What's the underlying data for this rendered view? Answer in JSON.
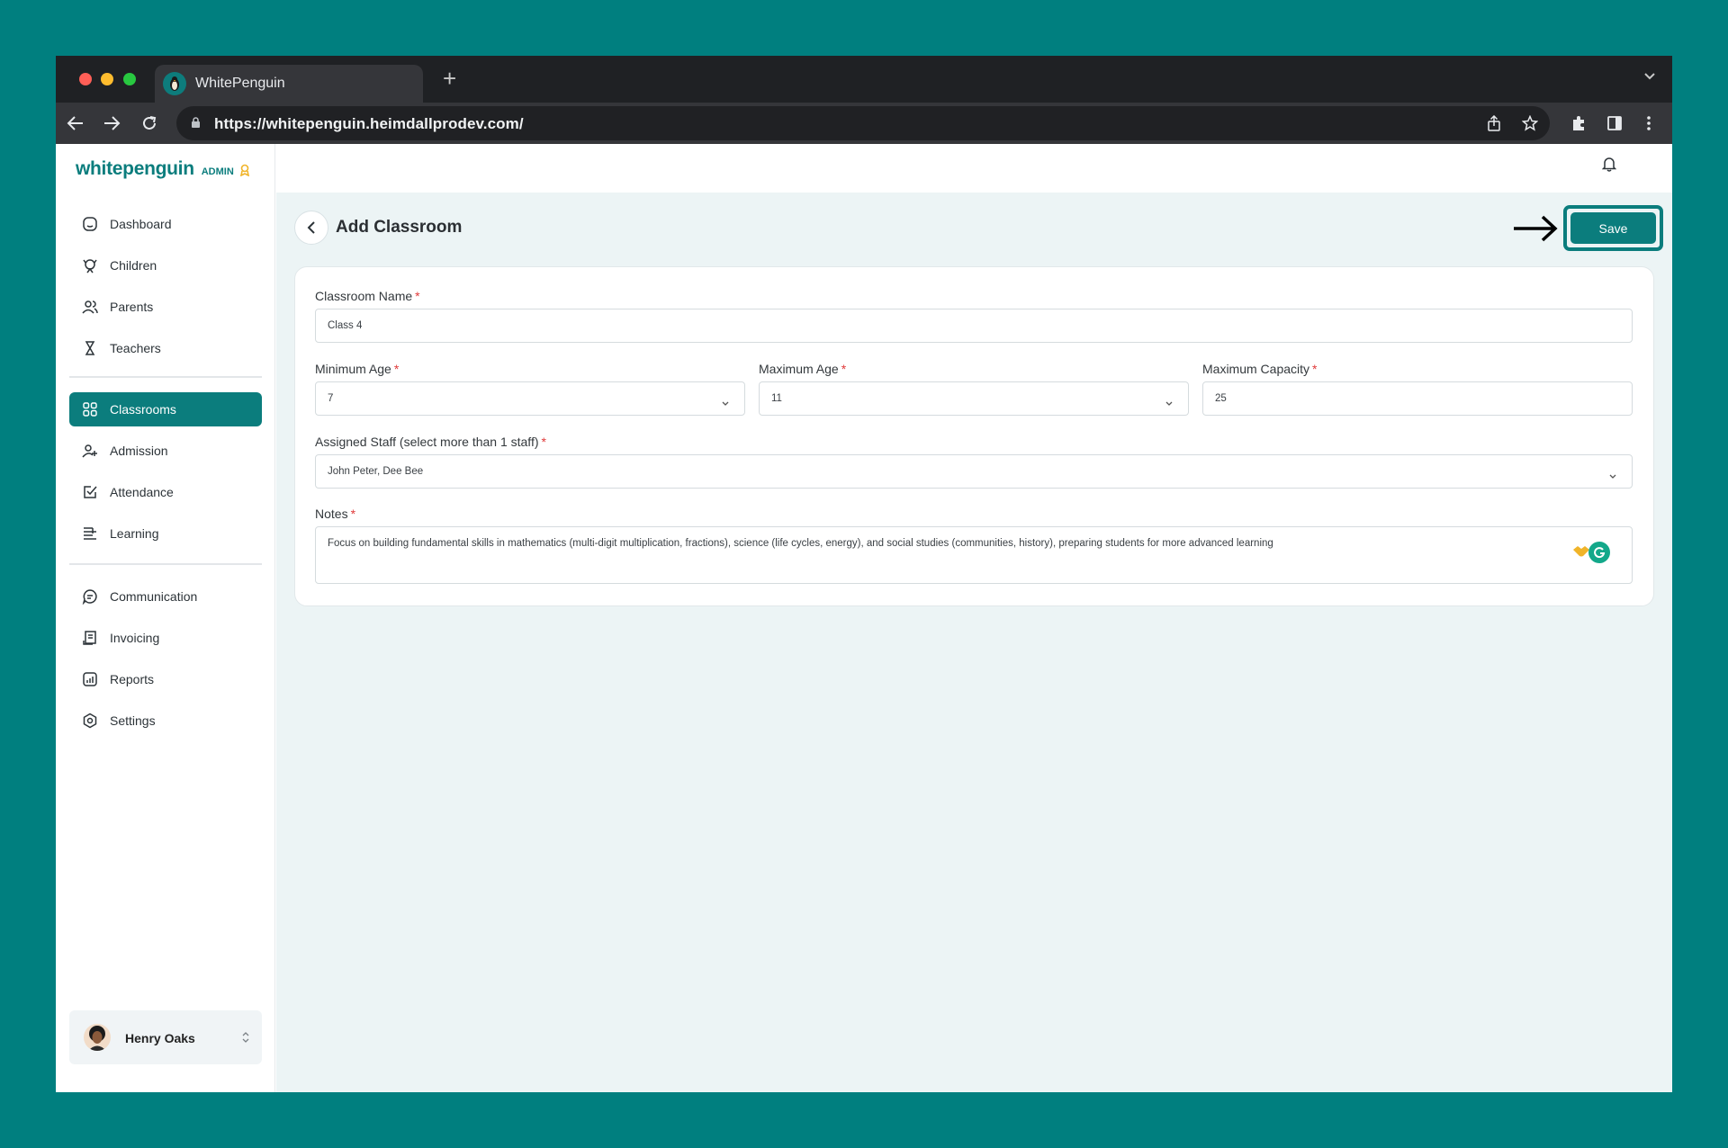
{
  "browser": {
    "tab_title": "WhitePenguin",
    "new_tab_label": "+",
    "url": "https://whitepenguin.heimdallprodev.com/"
  },
  "brand": {
    "name": "whitepenguin",
    "role": "ADMIN",
    "accent": "#0b7d7d"
  },
  "sidebar": {
    "items": [
      {
        "label": "Dashboard",
        "icon": "home-icon"
      },
      {
        "label": "Children",
        "icon": "child-icon"
      },
      {
        "label": "Parents",
        "icon": "parents-icon"
      },
      {
        "label": "Teachers",
        "icon": "teacher-icon"
      },
      {
        "label": "Classrooms",
        "icon": "grid-icon",
        "active": true
      },
      {
        "label": "Admission",
        "icon": "admission-icon"
      },
      {
        "label": "Attendance",
        "icon": "checkbox-icon"
      },
      {
        "label": "Learning",
        "icon": "learning-icon"
      },
      {
        "label": "Communication",
        "icon": "chat-icon"
      },
      {
        "label": "Invoicing",
        "icon": "invoice-icon"
      },
      {
        "label": "Reports",
        "icon": "chart-icon"
      },
      {
        "label": "Settings",
        "icon": "gear-icon"
      }
    ],
    "user": {
      "name": "Henry Oaks"
    }
  },
  "page": {
    "title": "Add Classroom",
    "save_label": "Save"
  },
  "form": {
    "classroom_name": {
      "label": "Classroom Name",
      "value": "Class 4"
    },
    "min_age": {
      "label": "Minimum Age",
      "value": "7"
    },
    "max_age": {
      "label": "Maximum Age",
      "value": "11"
    },
    "max_capacity": {
      "label": "Maximum Capacity",
      "value": "25"
    },
    "staff": {
      "label": "Assigned Staff (select more than 1 staff)",
      "value": "John Peter, Dee Bee"
    },
    "notes": {
      "label": "Notes",
      "value": "Focus on building fundamental skills in mathematics (multi-digit multiplication, fractions), science (life cycles, energy), and social studies (communities, history), preparing students for more advanced learning"
    },
    "required_mark": "*"
  }
}
